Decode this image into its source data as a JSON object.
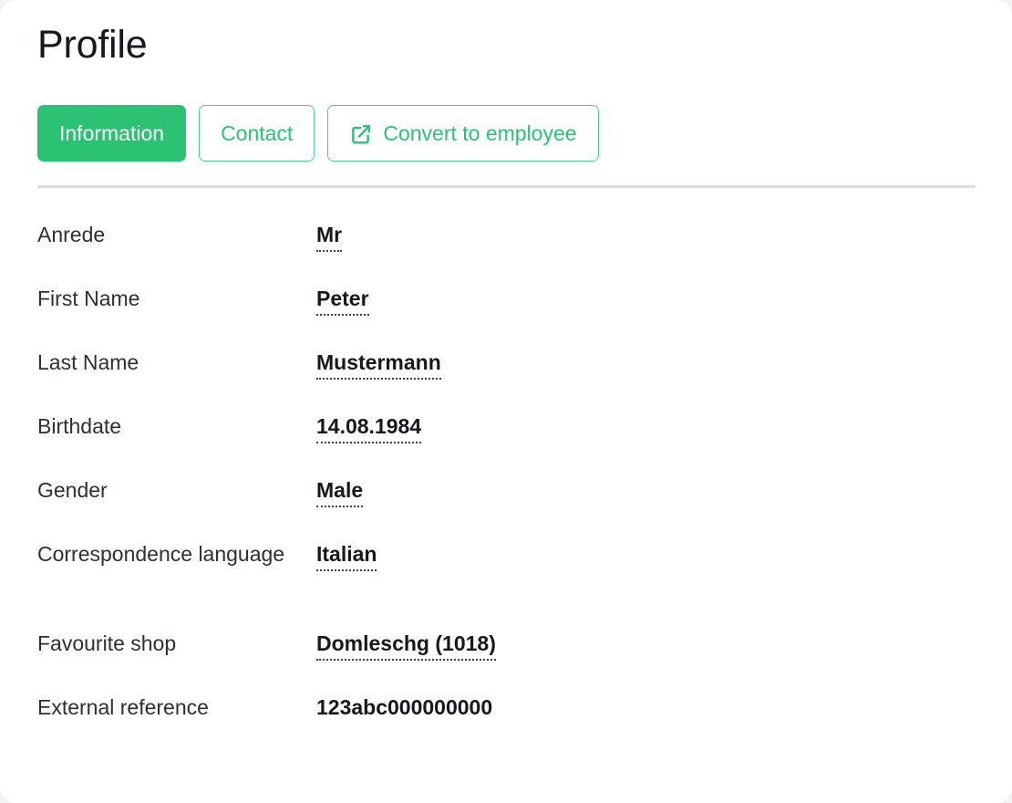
{
  "page": {
    "title": "Profile"
  },
  "tabs": [
    {
      "label": "Information",
      "style": "primary",
      "icon": null
    },
    {
      "label": "Contact",
      "style": "ghost",
      "icon": null
    },
    {
      "label": "Convert to employee",
      "style": "ghost",
      "icon": "external-link-icon"
    }
  ],
  "fields": [
    {
      "label": "Anrede",
      "value": "Mr",
      "editable": true,
      "spaced": false
    },
    {
      "label": "First Name",
      "value": "Peter",
      "editable": true,
      "spaced": false
    },
    {
      "label": "Last Name",
      "value": "Mustermann",
      "editable": true,
      "spaced": false
    },
    {
      "label": "Birthdate",
      "value": "14.08.1984",
      "editable": true,
      "spaced": false
    },
    {
      "label": "Gender",
      "value": "Male",
      "editable": true,
      "spaced": false
    },
    {
      "label": "Correspondence language",
      "value": "Italian",
      "editable": true,
      "spaced": false
    },
    {
      "label": "Favourite shop",
      "value": "Domleschg (1018)",
      "editable": true,
      "spaced": true
    },
    {
      "label": "External reference",
      "value": "123abc000000000",
      "editable": false,
      "spaced": false
    }
  ],
  "colors": {
    "accent": "#2bc274",
    "accent_border": "#4ecb8e",
    "card_background": "#ffffff",
    "page_background": "#f2f3f5",
    "divider": "#dcdcdd",
    "label_text": "#2b3037",
    "value_text": "#15181c",
    "title_text": "#15181c"
  }
}
